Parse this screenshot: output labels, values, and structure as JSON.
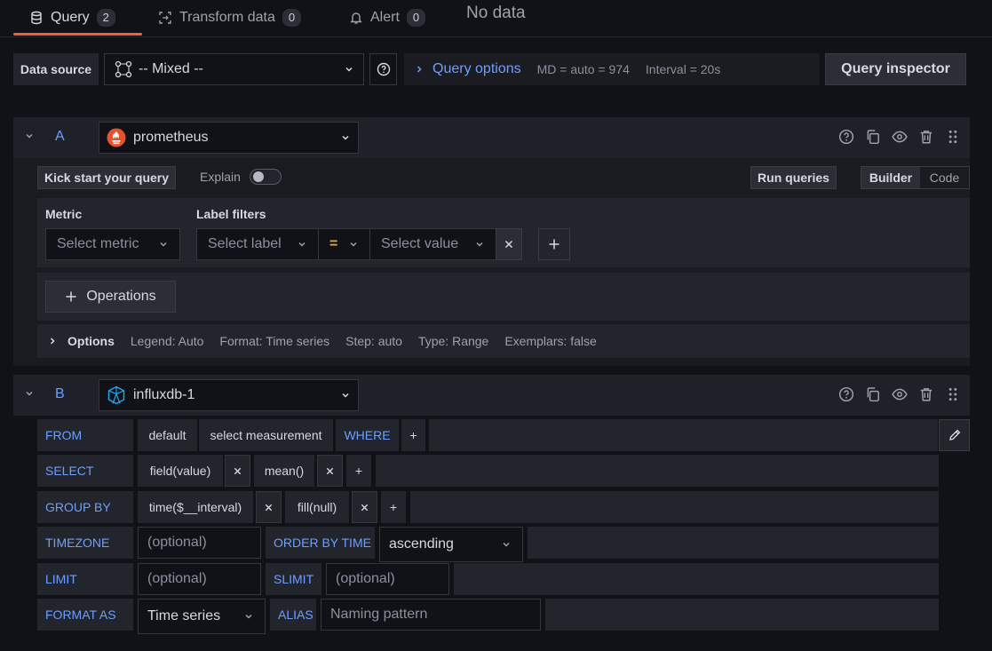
{
  "tabs": [
    {
      "label": "Query",
      "count": "2"
    },
    {
      "label": "Transform data",
      "count": "0"
    },
    {
      "label": "Alert",
      "count": "0"
    }
  ],
  "no_data": "No data",
  "datasource": {
    "label": "Data source",
    "value": "-- Mixed --"
  },
  "query_options": {
    "title": "Query options",
    "md": "MD = auto = 974",
    "interval": "Interval = 20s"
  },
  "query_inspector": "Query inspector",
  "query_a": {
    "ref_id": "A",
    "datasource": "prometheus",
    "kick_start": "Kick start your query",
    "explain": "Explain",
    "run_queries": "Run queries",
    "mode_builder": "Builder",
    "mode_code": "Code",
    "metric_label": "Metric",
    "metric_placeholder": "Select metric",
    "label_filters_label": "Label filters",
    "label_placeholder": "Select label",
    "operator": "=",
    "value_placeholder": "Select value",
    "operations": "Operations",
    "options": {
      "title": "Options",
      "legend": "Legend: Auto",
      "format": "Format: Time series",
      "step": "Step: auto",
      "type": "Type: Range",
      "exemplars": "Exemplars: false"
    }
  },
  "query_b": {
    "ref_id": "B",
    "datasource": "influxdb-1",
    "from_kw": "FROM",
    "from_policy": "default",
    "from_measurement": "select measurement",
    "where_kw": "WHERE",
    "select_kw": "SELECT",
    "select_field": "field(value)",
    "select_fn": "mean()",
    "groupby_kw": "GROUP BY",
    "groupby_time": "time($__interval)",
    "groupby_fill": "fill(null)",
    "plus": "+",
    "timezone_kw": "TIMEZONE",
    "timezone_placeholder": "(optional)",
    "orderby_kw": "ORDER BY TIME",
    "orderby_value": "ascending",
    "limit_kw": "LIMIT",
    "limit_placeholder": "(optional)",
    "slimit_kw": "SLIMIT",
    "slimit_placeholder": "(optional)",
    "format_kw": "FORMAT AS",
    "format_value": "Time series",
    "alias_kw": "ALIAS",
    "alias_placeholder": "Naming pattern"
  },
  "colors": {
    "accent_orange": "#f55f3e",
    "link_blue": "#6e9fff",
    "background": "#111217"
  }
}
